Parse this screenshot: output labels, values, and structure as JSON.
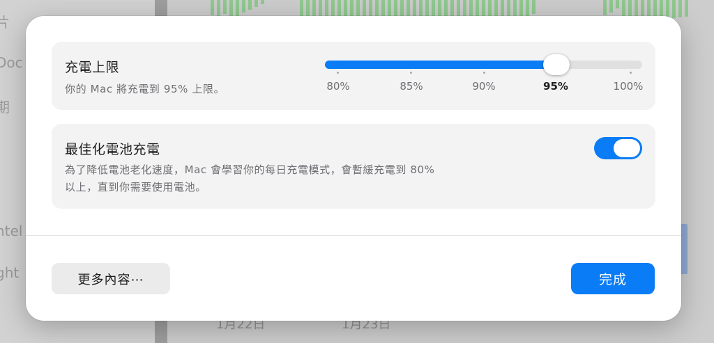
{
  "background": {
    "sidebar_fragments": [
      "片",
      "Doc",
      "期",
      "ntel",
      "ght"
    ],
    "dates": [
      "1月22日",
      "1月23日"
    ]
  },
  "dialog": {
    "charge_limit": {
      "title": "充電上限",
      "description": "你的 Mac 將充電到 95% 上限。",
      "slider": {
        "ticks": [
          "80%",
          "85%",
          "90%",
          "95%",
          "100%"
        ],
        "selected": "95%",
        "value": 0.73
      }
    },
    "optimized_charging": {
      "title": "最佳化電池充電",
      "description_line1": "為了降低電池老化速度，Mac 會學習你的每日充電模式，會暫緩充電到 80%",
      "description_line2": "以上，直到你需要使用電池。",
      "enabled": true
    },
    "buttons": {
      "more": "更多內容⋯",
      "done": "完成"
    }
  },
  "colors": {
    "accent": "#0a7cf5",
    "card_bg": "#f3f3f3",
    "chart_green": "#8fc98f"
  }
}
